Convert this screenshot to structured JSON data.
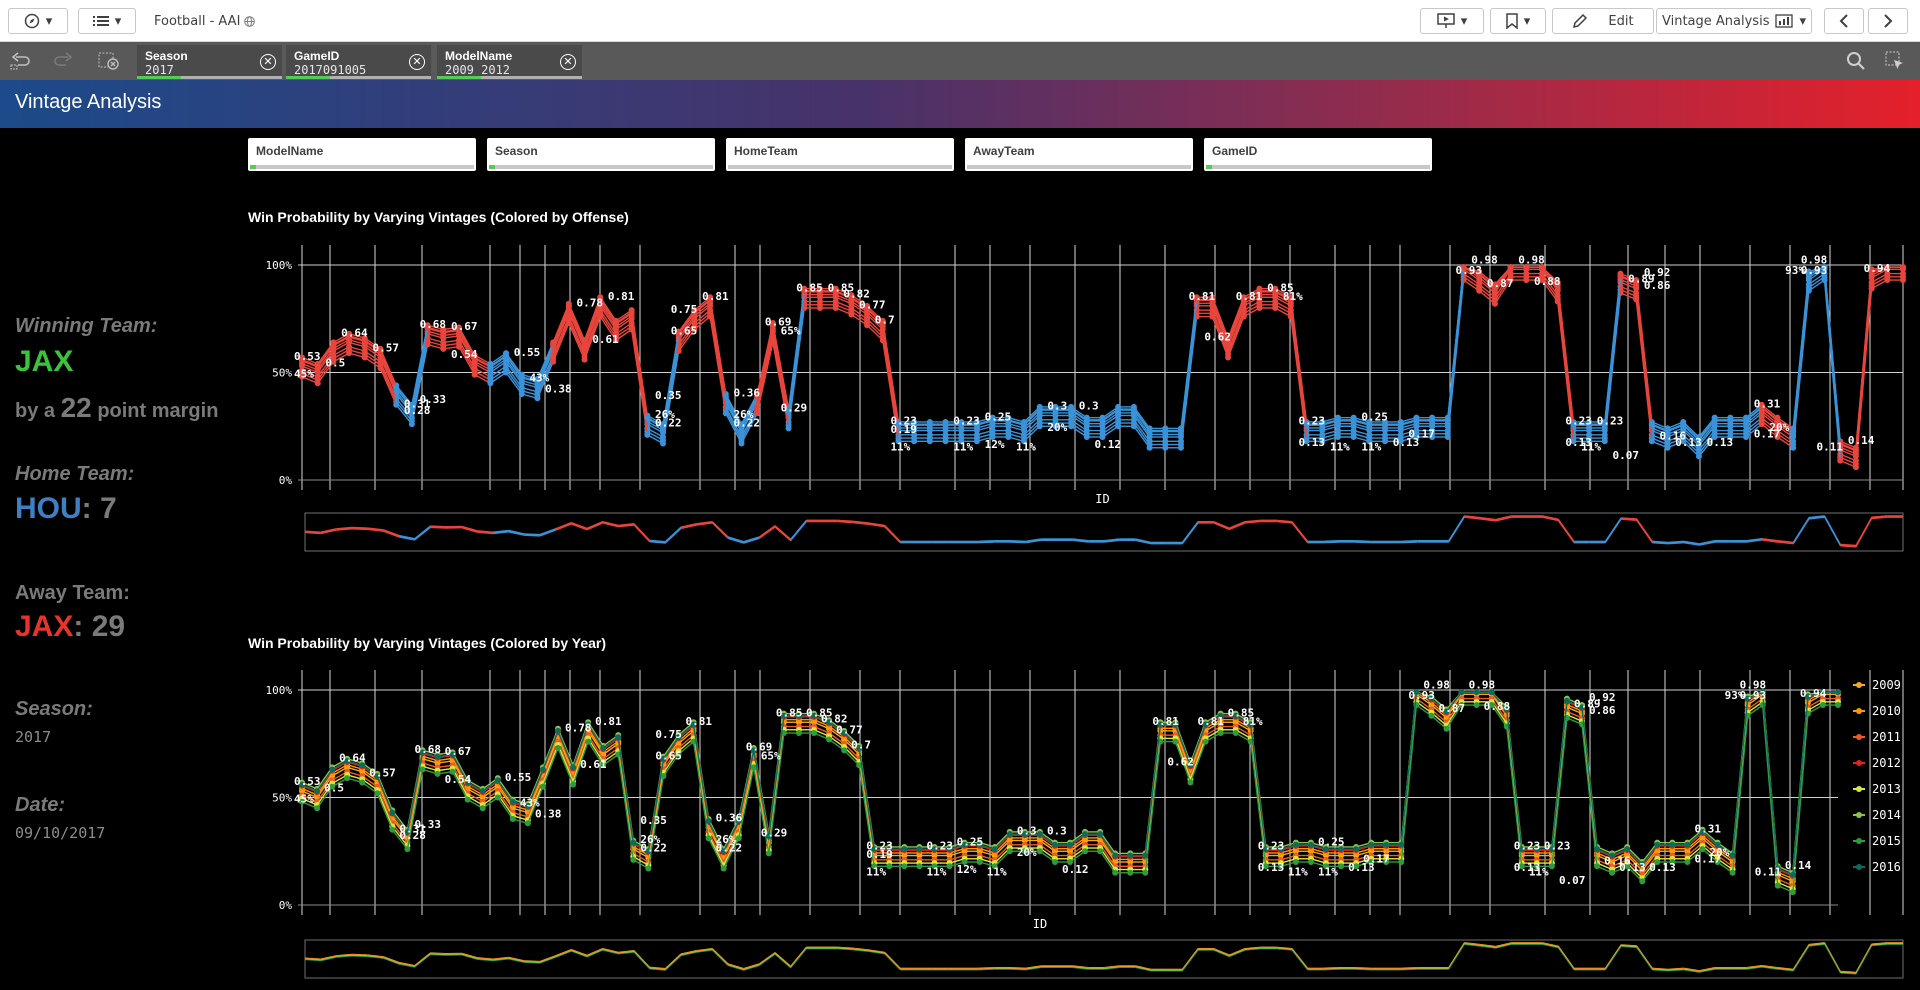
{
  "toolbar": {
    "app_title": "Football - AAI",
    "edit_label": "Edit",
    "sheet_label": "Vintage Analysis"
  },
  "selections": [
    {
      "label": "Season",
      "value": "2017"
    },
    {
      "label": "GameID",
      "value": "2017091005"
    },
    {
      "label": "ModelName",
      "value": "2009_2012"
    }
  ],
  "sheet": {
    "title": "Vintage Analysis"
  },
  "filters": [
    "ModelName",
    "Season",
    "HomeTeam",
    "AwayTeam",
    "GameID"
  ],
  "summary": {
    "winning_label": "Winning Team:",
    "winning_team": "JAX",
    "margin_prefix": "by a",
    "margin_value": "22",
    "margin_suffix": "point margin",
    "home_label": "Home Team:",
    "home_team": "HOU",
    "home_score": "7",
    "away_label": "Away Team:",
    "away_team": "JAX",
    "away_score": "29",
    "season_label": "Season:",
    "season_value": "2017",
    "date_label": "Date:",
    "date_value": "09/10/2017",
    "colon": ":"
  },
  "colors": {
    "winning": "#3cc33c",
    "home": "#3f7fc4",
    "away": "#e8352b",
    "offense_home": "#3a93d8",
    "offense_away": "#e8453c",
    "year_2009": "#f5a623",
    "year_2010": "#ff9800",
    "year_2011": "#f05a28",
    "year_2012": "#e52020",
    "year_2013": "#d7e83a",
    "year_2014": "#8bc34a",
    "year_2015": "#2e9b3e",
    "year_2016": "#0d6b5a"
  },
  "chart_data": [
    {
      "type": "line",
      "title": "Win Probability by Varying Vintages (Colored by Offense)",
      "xlabel": "ID",
      "ylabel": "",
      "yticks": [
        "0%",
        "50%",
        "100%"
      ],
      "ylim": [
        0,
        1
      ],
      "color_by": "offense",
      "x": [
        0,
        1,
        2,
        3,
        4,
        5,
        6,
        7,
        8,
        9,
        10,
        11,
        12,
        13,
        14,
        15,
        16,
        17,
        18,
        19,
        20,
        21,
        22,
        23,
        24,
        25,
        26,
        27,
        28,
        29,
        30,
        31,
        32,
        33,
        34,
        35,
        36,
        37,
        38,
        39,
        40,
        41,
        42,
        43,
        44,
        45,
        46,
        47,
        48,
        49,
        50,
        51,
        52,
        53,
        54,
        55,
        56,
        57,
        58,
        59,
        60,
        61,
        62,
        63,
        64,
        65,
        66,
        67,
        68,
        69,
        70,
        71,
        72,
        73,
        74,
        75,
        76,
        77,
        78,
        79,
        80,
        81,
        82,
        83,
        84,
        85,
        86,
        87,
        88,
        89,
        90,
        91,
        92,
        93,
        94,
        95,
        96,
        97,
        98,
        99,
        100,
        101,
        102,
        103,
        104,
        105,
        106,
        107,
        108,
        109,
        110,
        111,
        112
      ],
      "offense": [
        "away",
        "away",
        "away",
        "away",
        "away",
        "away",
        "home",
        "home",
        "away",
        "away",
        "away",
        "away",
        "home",
        "home",
        "home",
        "home",
        "away",
        "away",
        "away",
        "away",
        "away",
        "away",
        "home",
        "home",
        "away",
        "away",
        "away",
        "home",
        "home",
        "away",
        "away",
        "home",
        "away",
        "away",
        "away",
        "away",
        "away",
        "away",
        "home",
        "home",
        "home",
        "home",
        "home",
        "home",
        "home",
        "home",
        "home",
        "home",
        "home",
        "home",
        "home",
        "home",
        "home",
        "home",
        "home",
        "home",
        "home",
        "away",
        "away",
        "away",
        "away",
        "away",
        "away",
        "away",
        "home",
        "home",
        "home",
        "home",
        "home",
        "home",
        "home",
        "home",
        "home",
        "home",
        "away",
        "away",
        "away",
        "away",
        "away",
        "away",
        "away",
        "home",
        "home",
        "home",
        "away",
        "away",
        "home",
        "home",
        "home",
        "home",
        "home",
        "home",
        "home",
        "away",
        "away",
        "home",
        "home",
        "home",
        "away",
        "away",
        "away",
        "away"
      ],
      "series": [
        {
          "name": "2009",
          "values": [
            0.53,
            0.5,
            0.6,
            0.64,
            0.62,
            0.57,
            0.4,
            0.31,
            0.68,
            0.66,
            0.67,
            0.54,
            0.5,
            0.55,
            0.45,
            0.43,
            0.6,
            0.78,
            0.61,
            0.81,
            0.7,
            0.75,
            0.26,
            0.22,
            0.65,
            0.75,
            0.81,
            0.36,
            0.22,
            0.36,
            0.69,
            0.29,
            0.85,
            0.85,
            0.85,
            0.82,
            0.77,
            0.7,
            0.23,
            0.23,
            0.23,
            0.23,
            0.23,
            0.23,
            0.25,
            0.25,
            0.23,
            0.3,
            0.3,
            0.3,
            0.25,
            0.25,
            0.3,
            0.3,
            0.2,
            0.2,
            0.2,
            0.81,
            0.81,
            0.62,
            0.81,
            0.85,
            0.85,
            0.81,
            0.23,
            0.23,
            0.25,
            0.25,
            0.23,
            0.23,
            0.23,
            0.25,
            0.25,
            0.25,
            0.98,
            0.93,
            0.87,
            0.98,
            0.98,
            0.98,
            0.88,
            0.23,
            0.23,
            0.23,
            0.92,
            0.89,
            0.23,
            0.2,
            0.23,
            0.16,
            0.25,
            0.25,
            0.25,
            0.31,
            0.25,
            0.2,
            0.93,
            0.98,
            0.14,
            0.11,
            0.94,
            0.98,
            0.98
          ]
        }
      ]
    },
    {
      "type": "line",
      "title": "Win Probability by Varying Vintages (Colored by Year)",
      "xlabel": "ID",
      "ylabel": "",
      "yticks": [
        "0%",
        "50%",
        "100%"
      ],
      "ylim": [
        0,
        1
      ],
      "color_by": "year",
      "legend": [
        "2009",
        "2010",
        "2011",
        "2012",
        "2013",
        "2014",
        "2015",
        "2016"
      ],
      "legend_placement": "right"
    }
  ],
  "point_labels": [
    [
      0,
      0.53,
      "0.53"
    ],
    [
      0,
      0.45,
      "45%"
    ],
    [
      2,
      0.5,
      "0.5"
    ],
    [
      3,
      0.64,
      "0.64"
    ],
    [
      5,
      0.57,
      "0.57"
    ],
    [
      7,
      0.31,
      "0.31"
    ],
    [
      7,
      0.28,
      "0.28"
    ],
    [
      8,
      0.68,
      "0.68"
    ],
    [
      8,
      0.33,
      "0.33"
    ],
    [
      10,
      0.67,
      "0.67"
    ],
    [
      10,
      0.54,
      "0.54"
    ],
    [
      14,
      0.55,
      "0.55"
    ],
    [
      15,
      0.43,
      "43%"
    ],
    [
      16,
      0.38,
      "0.38"
    ],
    [
      18,
      0.78,
      "0.78"
    ],
    [
      19,
      0.61,
      "0.61"
    ],
    [
      20,
      0.81,
      "0.81"
    ],
    [
      24,
      0.75,
      "0.75"
    ],
    [
      24,
      0.65,
      "0.65"
    ],
    [
      23,
      0.35,
      "0.35"
    ],
    [
      23,
      0.26,
      "26%"
    ],
    [
      23,
      0.22,
      "0.22"
    ],
    [
      26,
      0.81,
      "0.81"
    ],
    [
      28,
      0.36,
      "0.36"
    ],
    [
      28,
      0.26,
      "26%"
    ],
    [
      28,
      0.22,
      "0.22"
    ],
    [
      30,
      0.69,
      "0.69"
    ],
    [
      31,
      0.65,
      "65%"
    ],
    [
      31,
      0.29,
      "0.29"
    ],
    [
      32,
      0.85,
      "0.85"
    ],
    [
      34,
      0.85,
      "0.85"
    ],
    [
      35,
      0.82,
      "0.82"
    ],
    [
      36,
      0.77,
      "0.77"
    ],
    [
      37,
      0.7,
      "0.7"
    ],
    [
      38,
      0.23,
      "0.23"
    ],
    [
      38,
      0.19,
      "0.19"
    ],
    [
      38,
      0.11,
      "11%"
    ],
    [
      42,
      0.23,
      "0.23"
    ],
    [
      42,
      0.11,
      "11%"
    ],
    [
      44,
      0.25,
      "0.25"
    ],
    [
      44,
      0.12,
      "12%"
    ],
    [
      46,
      0.11,
      "11%"
    ],
    [
      48,
      0.3,
      "0.3"
    ],
    [
      48,
      0.2,
      "20%"
    ],
    [
      50,
      0.3,
      "0.3"
    ],
    [
      51,
      0.12,
      "0.12"
    ],
    [
      57,
      0.81,
      "0.81"
    ],
    [
      58,
      0.62,
      "0.62"
    ],
    [
      60,
      0.81,
      "0.81"
    ],
    [
      62,
      0.85,
      "0.85"
    ],
    [
      63,
      0.81,
      "81%"
    ],
    [
      64,
      0.23,
      "0.23"
    ],
    [
      64,
      0.13,
      "0.13"
    ],
    [
      66,
      0.11,
      "11%"
    ],
    [
      68,
      0.25,
      "0.25"
    ],
    [
      68,
      0.11,
      "11%"
    ],
    [
      70,
      0.13,
      "0.13"
    ],
    [
      71,
      0.17,
      "0.17"
    ],
    [
      74,
      0.93,
      "0.93"
    ],
    [
      75,
      0.98,
      "0.98"
    ],
    [
      76,
      0.87,
      "0.87"
    ],
    [
      78,
      0.98,
      "0.98"
    ],
    [
      79,
      0.88,
      "0.88"
    ],
    [
      81,
      0.23,
      "0.23"
    ],
    [
      81,
      0.13,
      "0.13"
    ],
    [
      82,
      0.11,
      "11%"
    ],
    [
      83,
      0.23,
      "0.23"
    ],
    [
      84,
      0.07,
      "0.07"
    ],
    [
      85,
      0.89,
      "0.89"
    ],
    [
      86,
      0.92,
      "0.92"
    ],
    [
      86,
      0.86,
      "0.86"
    ],
    [
      87,
      0.16,
      "0.16"
    ],
    [
      88,
      0.13,
      "0.13"
    ],
    [
      90,
      0.13,
      "0.13"
    ],
    [
      93,
      0.31,
      "0.31"
    ],
    [
      93,
      0.17,
      "0.17"
    ],
    [
      94,
      0.2,
      "20%"
    ],
    [
      95,
      0.93,
      "93%"
    ],
    [
      96,
      0.98,
      "0.98"
    ],
    [
      96,
      0.93,
      "0.93"
    ],
    [
      97,
      0.11,
      "0.11"
    ],
    [
      99,
      0.14,
      "0.14"
    ],
    [
      100,
      0.94,
      "0.94"
    ]
  ]
}
